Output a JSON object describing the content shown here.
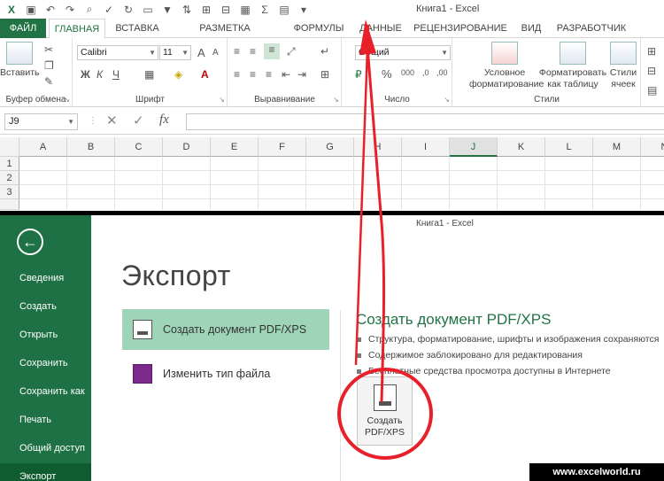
{
  "excel": {
    "window_title": "Книга1 - Excel",
    "tabs": [
      "ФАЙЛ",
      "ГЛАВНАЯ",
      "ВСТАВКА",
      "РАЗМЕТКА СТРАНИЦЫ",
      "ФОРМУЛЫ",
      "ДАННЫЕ",
      "РЕЦЕНЗИРОВАНИЕ",
      "ВИД",
      "РАЗРАБОТЧИК"
    ],
    "active_tab": "ГЛАВНАЯ",
    "clipboard": {
      "paste_label": "Вставить",
      "group_label": "Буфер обмена"
    },
    "font": {
      "name": "Calibri",
      "size": "11",
      "bold": "Ж",
      "italic": "К",
      "underline": "Ч",
      "grow": "A",
      "shrink": "A",
      "group_label": "Шрифт"
    },
    "alignment": {
      "group_label": "Выравнивание"
    },
    "number": {
      "format": "Общий",
      "percent": "%",
      "group_label": "Число"
    },
    "styles": {
      "conditional_label_1": "Условное",
      "conditional_label_2": "форматирование",
      "table_label_1": "Форматировать",
      "table_label_2": "как таблицу",
      "cell_label_1": "Стили",
      "cell_label_2": "ячеек",
      "group_label": "Стили"
    },
    "name_box": "J9",
    "fx": "fx",
    "columns": [
      "A",
      "B",
      "C",
      "D",
      "E",
      "F",
      "G",
      "H",
      "I",
      "J",
      "K",
      "L",
      "M",
      "N"
    ],
    "selected_column": "J",
    "rows": [
      "1",
      "2",
      "3"
    ]
  },
  "backstage": {
    "window_title": "Книга1 - Excel",
    "nav": [
      "Сведения",
      "Создать",
      "Открыть",
      "Сохранить",
      "Сохранить как",
      "Печать",
      "Общий доступ",
      "Экспорт"
    ],
    "active_nav": "Экспорт",
    "heading": "Экспорт",
    "options": [
      "Создать документ PDF/XPS",
      "Изменить тип файла"
    ],
    "section_title": "Создать документ PDF/XPS",
    "bullets": [
      "Структура, форматирование, шрифты и изображения сохраняются",
      "Содержимое заблокировано для редактирования",
      "Бесплатные средства просмотра доступны в Интернете"
    ],
    "create_button_1": "Создать",
    "create_button_2": "PDF/XPS"
  },
  "watermark": "www.excelworld.ru",
  "colors": {
    "excel_green": "#217346",
    "backstage_nav": "#1e7145",
    "selected_option": "#9fd5b7",
    "annotation_red": "#e8202a"
  }
}
